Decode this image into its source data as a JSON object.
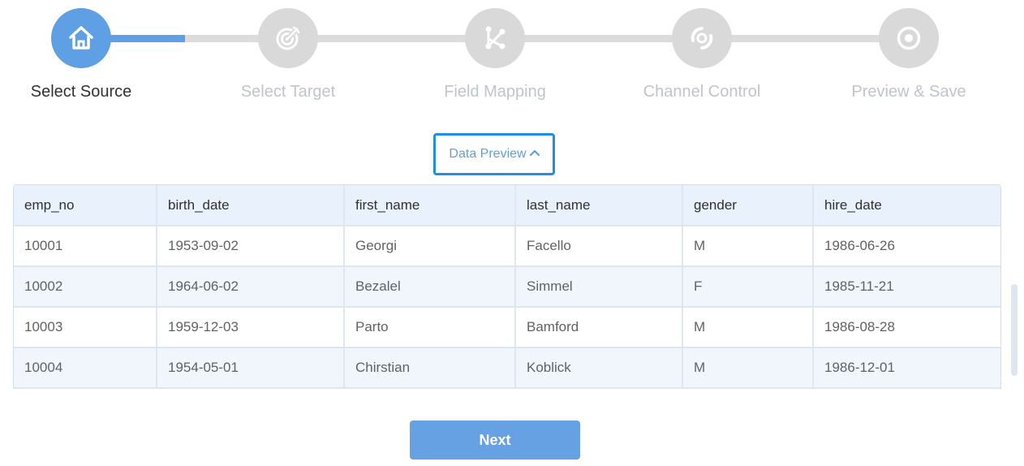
{
  "steps": [
    {
      "label": "Select Source",
      "icon": "home-icon",
      "active": true
    },
    {
      "label": "Select Target",
      "icon": "target-icon",
      "active": false
    },
    {
      "label": "Field Mapping",
      "icon": "branch-icon",
      "active": false
    },
    {
      "label": "Channel Control",
      "icon": "channel-icon",
      "active": false
    },
    {
      "label": "Preview & Save",
      "icon": "eye-icon",
      "active": false
    }
  ],
  "colors": {
    "accent": "#5f9fe3",
    "inactive_step": "#d9d9d9",
    "toggle_border": "#1e8fe1"
  },
  "preview_toggle": {
    "label": "Data Preview",
    "icon": "chevron-up-icon"
  },
  "table": {
    "columns": [
      "emp_no",
      "birth_date",
      "first_name",
      "last_name",
      "gender",
      "hire_date"
    ],
    "rows": [
      [
        "10001",
        "1953-09-02",
        "Georgi",
        "Facello",
        "M",
        "1986-06-26"
      ],
      [
        "10002",
        "1964-06-02",
        "Bezalel",
        "Simmel",
        "F",
        "1985-11-21"
      ],
      [
        "10003",
        "1959-12-03",
        "Parto",
        "Bamford",
        "M",
        "1986-08-28"
      ],
      [
        "10004",
        "1954-05-01",
        "Chirstian",
        "Koblick",
        "M",
        "1986-12-01"
      ]
    ]
  },
  "next_button": {
    "label": "Next"
  }
}
